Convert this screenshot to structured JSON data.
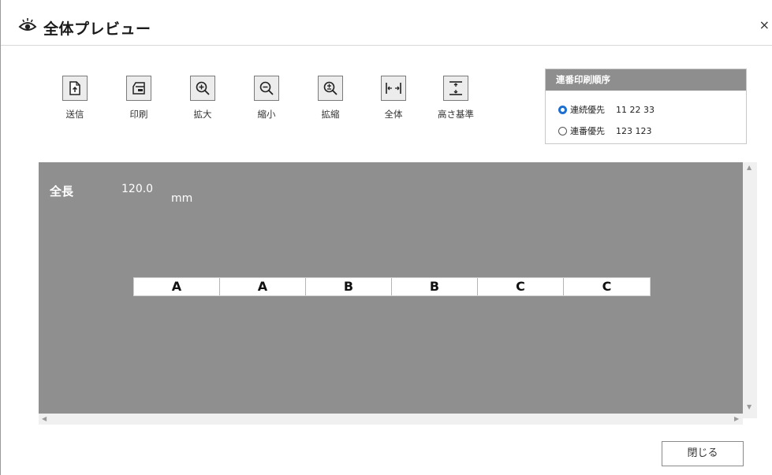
{
  "window": {
    "title": "全体プレビュー",
    "close_glyph": "×"
  },
  "toolbar": {
    "items": [
      {
        "name": "send",
        "label": "送信",
        "icon": "upload-doc-icon"
      },
      {
        "name": "print",
        "label": "印刷",
        "icon": "print-icon"
      },
      {
        "name": "zoom-in",
        "label": "拡大",
        "icon": "zoom-in-icon"
      },
      {
        "name": "zoom-out",
        "label": "縮小",
        "icon": "zoom-out-icon"
      },
      {
        "name": "zoom-fit",
        "label": "拡縮",
        "icon": "zoom-plusminus-icon"
      },
      {
        "name": "whole",
        "label": "全体",
        "icon": "fit-width-icon"
      },
      {
        "name": "height-base",
        "label": "高さ基準",
        "icon": "fit-height-icon"
      }
    ]
  },
  "order_panel": {
    "title": "連番印刷順序",
    "options": [
      {
        "label": "連続優先",
        "example": "11 22 33",
        "selected": true
      },
      {
        "label": "連番優先",
        "example": "123 123",
        "selected": false
      }
    ]
  },
  "preview": {
    "length_label": "全長",
    "length_value": "120.0",
    "length_unit": "mm",
    "cells": [
      "A",
      "A",
      "B",
      "B",
      "C",
      "C"
    ]
  },
  "footer": {
    "close_label": "閉じる"
  },
  "colors": {
    "preview_bg": "#8f8f8f",
    "panel_header": "#8e8e8e",
    "radio_accent": "#1e6fd0"
  }
}
